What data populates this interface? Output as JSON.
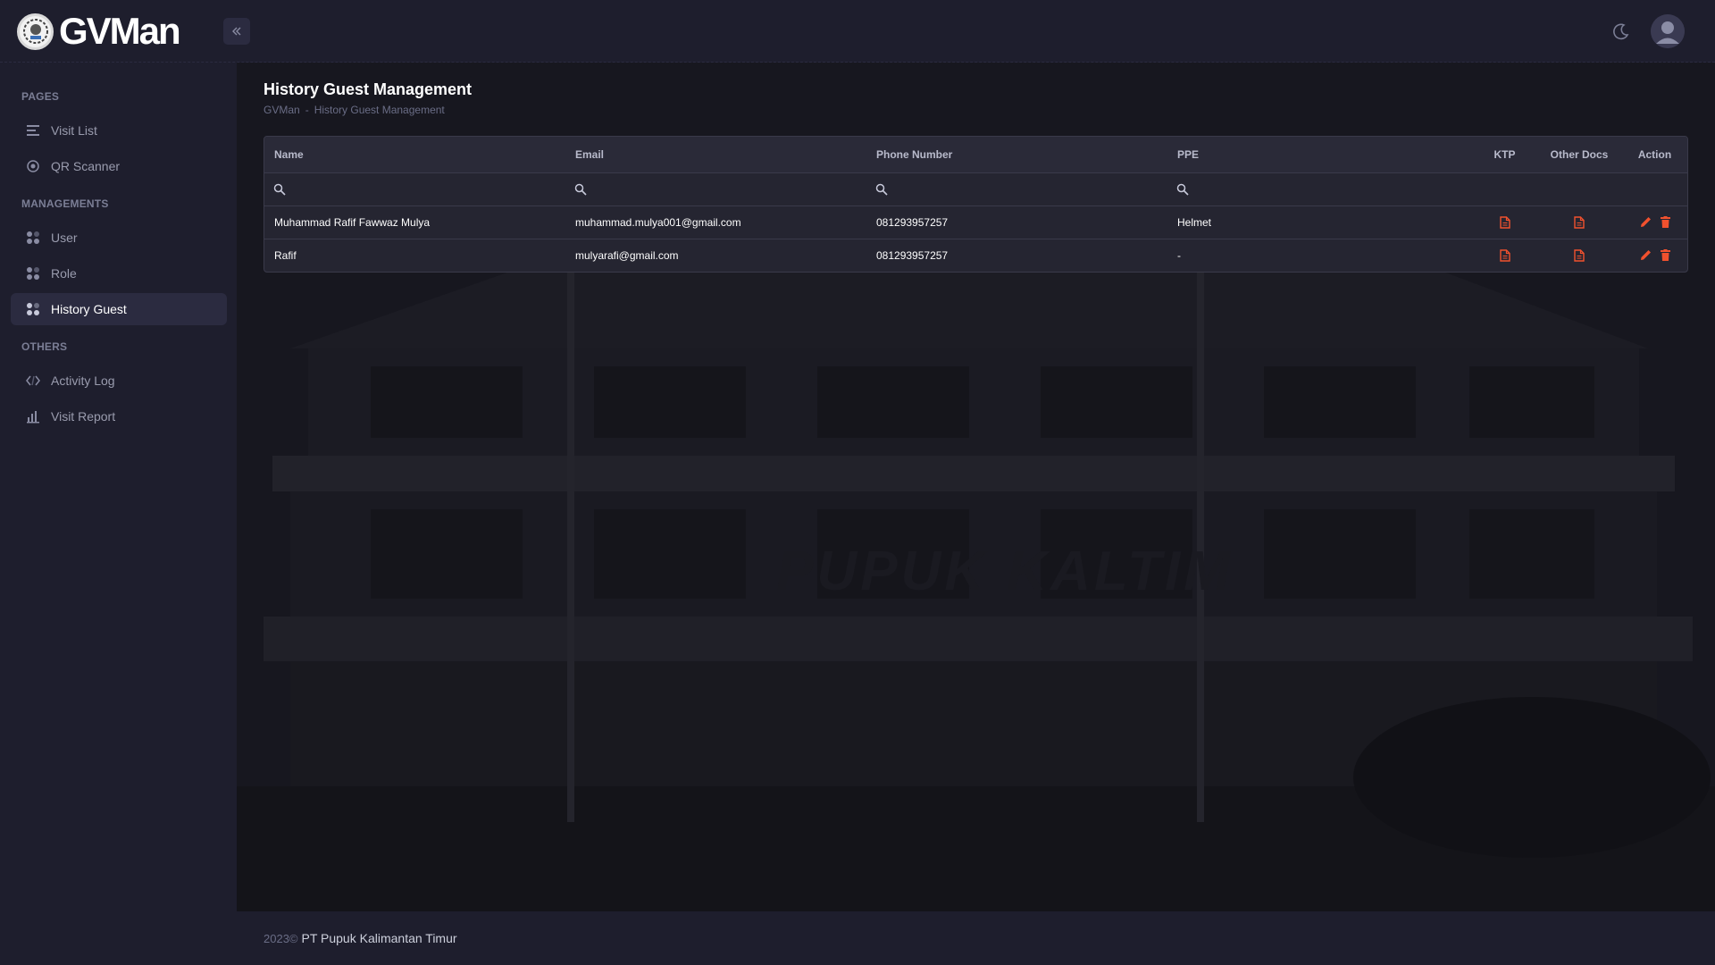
{
  "header": {
    "app_name": "GVMan",
    "collapse_icon": "double-chevron-left-icon",
    "theme_icon": "moon-icon",
    "avatar_icon": "user-avatar-icon"
  },
  "sidebar": {
    "sections": [
      {
        "title": "PAGES",
        "items": [
          {
            "label": "Visit List",
            "icon": "list-icon"
          },
          {
            "label": "QR Scanner",
            "icon": "target-icon"
          }
        ]
      },
      {
        "title": "MANAGEMENTS",
        "items": [
          {
            "label": "User",
            "icon": "grid-dots-icon"
          },
          {
            "label": "Role",
            "icon": "grid-dots-icon"
          },
          {
            "label": "History Guest",
            "icon": "grid-dots-icon",
            "active": true
          }
        ]
      },
      {
        "title": "OTHERS",
        "items": [
          {
            "label": "Activity Log",
            "icon": "code-icon"
          },
          {
            "label": "Visit Report",
            "icon": "bar-chart-icon"
          }
        ]
      }
    ]
  },
  "main": {
    "title": "History Guest Management",
    "breadcrumb": [
      "GVMan",
      "History Guest Management"
    ],
    "breadcrumb_separator": "-",
    "background_watermark": "PUPUK KALTIM",
    "table": {
      "columns": [
        "Name",
        "Email",
        "Phone Number",
        "PPE",
        "KTP",
        "Other Docs",
        "Action"
      ],
      "rows": [
        {
          "name": "Muhammad Rafif Fawwaz Mulya",
          "email": "muhammad.mulya001@gmail.com",
          "phone": "081293957257",
          "ppe": "Helmet"
        },
        {
          "name": "Rafif",
          "email": "mulyarafi@gmail.com",
          "phone": "081293957257",
          "ppe": "-"
        }
      ]
    }
  },
  "footer": {
    "year": "2023©",
    "company": "PT Pupuk Kalimantan Timur"
  },
  "colors": {
    "accent_orange": "#f1512e",
    "background": "#1e1e2d",
    "content_bg": "#17171f"
  }
}
